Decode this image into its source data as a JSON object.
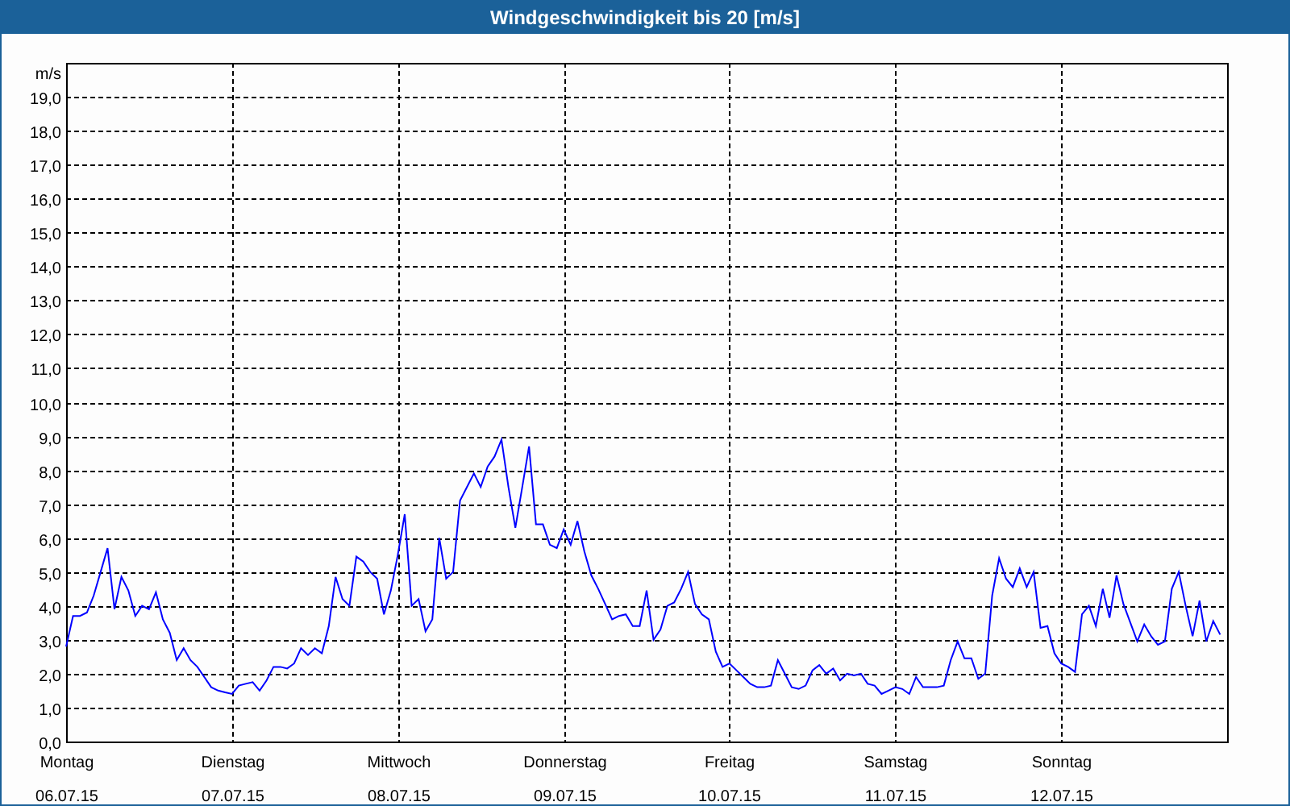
{
  "window": {
    "title": "Windgeschwindigkeit bis 20 [m/s]"
  },
  "chart_data": {
    "type": "line",
    "grid": true,
    "ylabel": "m/s",
    "ylim": [
      0,
      20
    ],
    "yticks": [
      {
        "value": 0,
        "label": "0,0"
      },
      {
        "value": 1,
        "label": "1,0"
      },
      {
        "value": 2,
        "label": "2,0"
      },
      {
        "value": 3,
        "label": "3,0"
      },
      {
        "value": 4,
        "label": "4,0"
      },
      {
        "value": 5,
        "label": "5,0"
      },
      {
        "value": 6,
        "label": "6,0"
      },
      {
        "value": 7,
        "label": "7,0"
      },
      {
        "value": 8,
        "label": "8,0"
      },
      {
        "value": 9,
        "label": "9,0"
      },
      {
        "value": 10,
        "label": "10,0"
      },
      {
        "value": 11,
        "label": "11,0"
      },
      {
        "value": 12,
        "label": "12,0"
      },
      {
        "value": 13,
        "label": "13,0"
      },
      {
        "value": 14,
        "label": "14,0"
      },
      {
        "value": 15,
        "label": "15,0"
      },
      {
        "value": 16,
        "label": "16,0"
      },
      {
        "value": 17,
        "label": "17,0"
      },
      {
        "value": 18,
        "label": "18,0"
      },
      {
        "value": 19,
        "label": "19,0"
      }
    ],
    "categories": [
      "Montag\n06.07.15",
      null,
      null,
      null,
      null,
      null,
      null,
      null,
      null,
      null,
      null,
      null,
      null,
      null,
      null,
      null,
      null,
      null,
      null,
      null,
      null,
      null,
      null,
      null,
      "Dienstag\n07.07.15",
      null,
      null,
      null,
      null,
      null,
      null,
      null,
      null,
      null,
      null,
      null,
      null,
      null,
      null,
      null,
      null,
      null,
      null,
      null,
      null,
      null,
      null,
      null,
      "Mittwoch\n08.07.15",
      null,
      null,
      null,
      null,
      null,
      null,
      null,
      null,
      null,
      null,
      null,
      null,
      null,
      null,
      null,
      null,
      null,
      null,
      null,
      null,
      null,
      null,
      null,
      "Donnerstag\n09.07.15",
      null,
      null,
      null,
      null,
      null,
      null,
      null,
      null,
      null,
      null,
      null,
      null,
      null,
      null,
      null,
      null,
      null,
      null,
      null,
      null,
      null,
      null,
      null,
      "Freitag\n10.07.15",
      null,
      null,
      null,
      null,
      null,
      null,
      null,
      null,
      null,
      null,
      null,
      null,
      null,
      null,
      null,
      null,
      null,
      null,
      null,
      null,
      null,
      null,
      null,
      "Samstag\n11.07.15",
      null,
      null,
      null,
      null,
      null,
      null,
      null,
      null,
      null,
      null,
      null,
      null,
      null,
      null,
      null,
      null,
      null,
      null,
      null,
      null,
      null,
      null,
      null,
      "Sonntag\n12.07.15",
      null,
      null,
      null,
      null,
      null,
      null,
      null,
      null,
      null,
      null,
      null,
      null,
      null,
      null,
      null,
      null,
      null,
      null,
      null,
      null,
      null,
      null,
      null
    ],
    "series": [
      {
        "color": "#0000ff",
        "values": [
          2.8,
          3.7,
          3.7,
          3.8,
          4.3,
          5.0,
          5.7,
          3.9,
          4.85,
          4.45,
          3.7,
          4.0,
          3.9,
          4.4,
          3.6,
          3.2,
          2.4,
          2.75,
          2.4,
          2.2,
          1.9,
          1.6,
          1.5,
          1.45,
          1.4,
          1.65,
          1.7,
          1.75,
          1.5,
          1.8,
          2.2,
          2.2,
          2.15,
          2.3,
          2.75,
          2.55,
          2.75,
          2.6,
          3.4,
          4.85,
          4.2,
          4.0,
          5.45,
          5.3,
          5.0,
          4.8,
          3.75,
          4.45,
          5.5,
          6.7,
          4.0,
          4.2,
          3.25,
          3.6,
          6.0,
          4.8,
          5.0,
          7.1,
          7.5,
          7.9,
          7.5,
          8.1,
          8.4,
          8.9,
          7.5,
          6.3,
          7.5,
          8.7,
          6.4,
          6.4,
          5.8,
          5.7,
          6.25,
          5.8,
          6.5,
          5.6,
          4.9,
          4.5,
          4.05,
          3.6,
          3.7,
          3.75,
          3.4,
          3.4,
          4.45,
          3.0,
          3.3,
          4.0,
          4.1,
          4.5,
          5.0,
          4.05,
          3.75,
          3.6,
          2.65,
          2.2,
          2.3,
          2.1,
          1.9,
          1.7,
          1.6,
          1.6,
          1.65,
          2.4,
          2.0,
          1.6,
          1.55,
          1.65,
          2.1,
          2.25,
          2.0,
          2.15,
          1.8,
          2.0,
          1.95,
          2.0,
          1.7,
          1.65,
          1.4,
          1.5,
          1.6,
          1.55,
          1.4,
          1.9,
          1.6,
          1.6,
          1.6,
          1.65,
          2.4,
          2.95,
          2.45,
          2.45,
          1.85,
          2.0,
          4.3,
          5.4,
          4.8,
          4.55,
          5.1,
          4.55,
          5.0,
          3.35,
          3.4,
          2.6,
          2.3,
          2.2,
          2.05,
          3.75,
          4.0,
          3.4,
          4.5,
          3.65,
          4.9,
          4.05,
          3.5,
          2.95,
          3.45,
          3.1,
          2.85,
          2.95,
          4.5,
          5.0,
          4.0,
          3.1,
          4.15,
          2.95,
          3.55,
          3.15
        ]
      }
    ]
  }
}
